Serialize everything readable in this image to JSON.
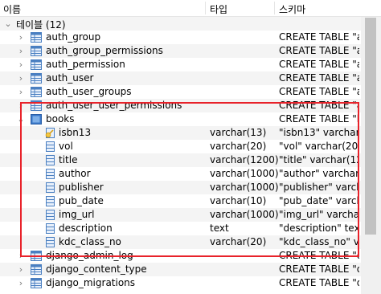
{
  "header": {
    "name_col": "이름",
    "type_col": "타입",
    "schema_col": "스키마"
  },
  "root": {
    "label": "테이블 (12)"
  },
  "tables": [
    {
      "name": "auth_group",
      "schema": "CREATE TABLE \"aut"
    },
    {
      "name": "auth_group_permissions",
      "schema": "CREATE TABLE \"aut"
    },
    {
      "name": "auth_permission",
      "schema": "CREATE TABLE \"aut"
    },
    {
      "name": "auth_user",
      "schema": "CREATE TABLE \"aut"
    },
    {
      "name": "auth_user_groups",
      "schema": "CREATE TABLE \"aut"
    },
    {
      "name": "auth_user_user_permissions",
      "schema": "CREATE TABLE \"aut"
    }
  ],
  "books": {
    "name": "books",
    "schema": "CREATE TABLE \"boo",
    "columns": [
      {
        "name": "isbn13",
        "type": "varchar(13)",
        "schema": "\"isbn13\" varchar(13)"
      },
      {
        "name": "vol",
        "type": "varchar(20)",
        "schema": "\"vol\" varchar(20)"
      },
      {
        "name": "title",
        "type": "varchar(1200)",
        "schema": "\"title\" varchar(1200)"
      },
      {
        "name": "author",
        "type": "varchar(1000)",
        "schema": "\"author\" varchar(1000)"
      },
      {
        "name": "publisher",
        "type": "varchar(1000)",
        "schema": "\"publisher\" varchar("
      },
      {
        "name": "pub_date",
        "type": "varchar(10)",
        "schema": "\"pub_date\" varchar(1"
      },
      {
        "name": "img_url",
        "type": "varchar(1000)",
        "schema": "\"img_url\" varchar(10"
      },
      {
        "name": "description",
        "type": "text",
        "schema": "\"description\" text"
      },
      {
        "name": "kdc_class_no",
        "type": "varchar(20)",
        "schema": "\"kdc_class_no\" varc"
      }
    ]
  },
  "tables_after": [
    {
      "name": "django_admin_log",
      "schema": "CREATE TABLE \"dja"
    },
    {
      "name": "django_content_type",
      "schema": "CREATE TABLE \"dja"
    },
    {
      "name": "django_migrations",
      "schema": "CREATE TABLE \"dja"
    }
  ],
  "colors": {
    "highlight": "#e8222a",
    "table_icon": "#4a7fc1",
    "key_icon": "#d9a21b"
  }
}
